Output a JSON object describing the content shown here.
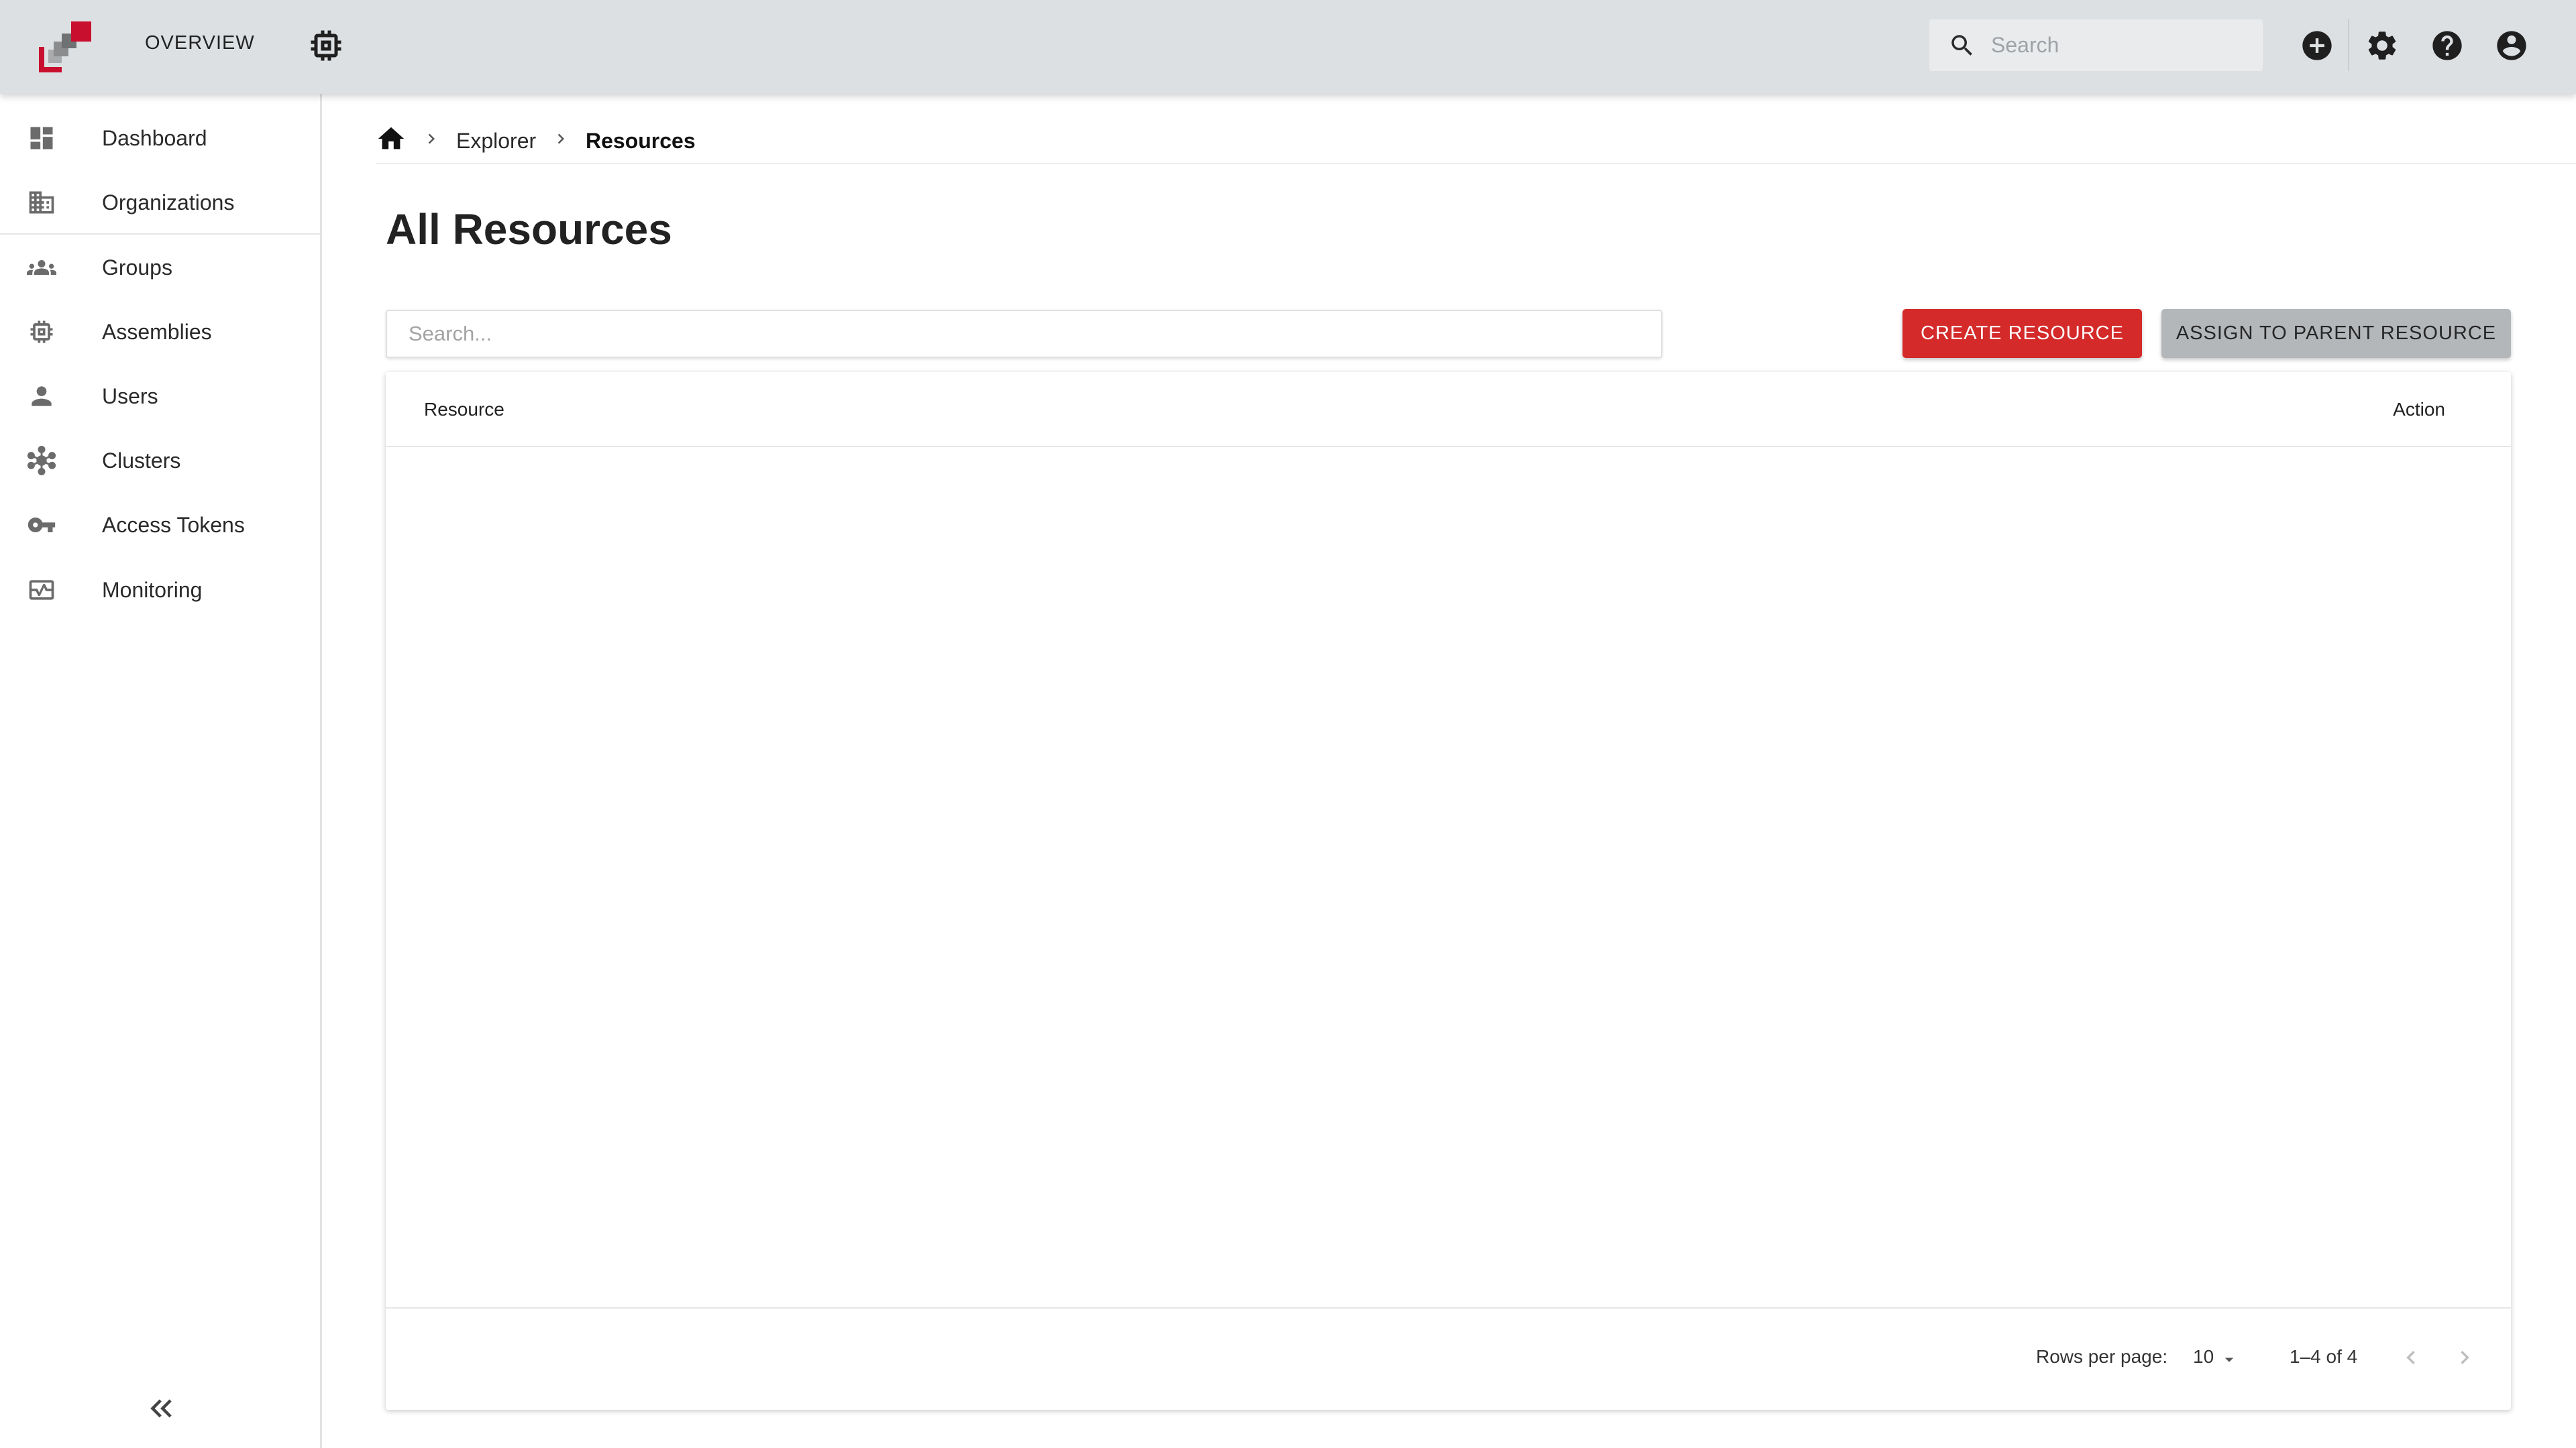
{
  "topbar": {
    "overview_label": "OVERVIEW",
    "search_placeholder": "Search",
    "brand_colors": {
      "red": "#c8102e",
      "gray": "#8a8c8e"
    }
  },
  "sidebar": {
    "items": [
      {
        "label": "Dashboard",
        "icon": "dashboard-icon"
      },
      {
        "label": "Organizations",
        "icon": "building-icon"
      },
      {
        "label": "Groups",
        "icon": "groups-icon"
      },
      {
        "label": "Assemblies",
        "icon": "chip-icon"
      },
      {
        "label": "Users",
        "icon": "person-icon"
      },
      {
        "label": "Clusters",
        "icon": "hub-icon"
      },
      {
        "label": "Access Tokens",
        "icon": "key-icon"
      },
      {
        "label": "Monitoring",
        "icon": "monitoring-icon"
      }
    ]
  },
  "breadcrumb": {
    "items": [
      "Explorer",
      "Resources"
    ]
  },
  "page": {
    "title": "All Resources",
    "search_placeholder": "Search...",
    "create_button": "CREATE RESOURCE",
    "assign_button": "ASSIGN TO PARENT RESOURCE"
  },
  "table": {
    "columns": [
      "Resource",
      "Action"
    ],
    "rows": []
  },
  "pagination": {
    "rows_per_page_label": "Rows per page:",
    "rows_per_page_value": "10",
    "range": "1–4 of 4"
  },
  "colors": {
    "accent_red": "#d42a2a",
    "secondary_gray": "#b4b7ba",
    "topbar_bg": "#dde0e3"
  }
}
